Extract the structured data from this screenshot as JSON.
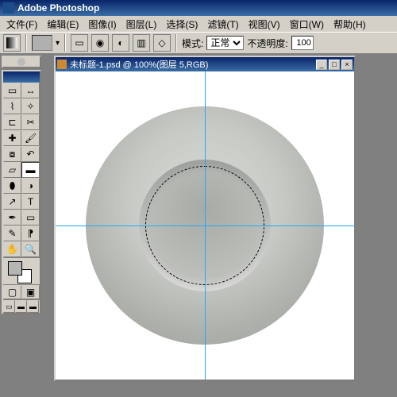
{
  "app": {
    "title": "Adobe Photoshop"
  },
  "menu": {
    "file": "文件(F)",
    "edit": "编辑(E)",
    "image": "图像(I)",
    "layer": "图层(L)",
    "select": "选择(S)",
    "filter": "滤镜(T)",
    "view": "视图(V)",
    "window": "窗口(W)",
    "help": "帮助(H)"
  },
  "options": {
    "mode_label": "模式:",
    "mode_value": "正常",
    "opacity_label": "不透明度:",
    "opacity_value": "100"
  },
  "document": {
    "title": "未标题-1.psd @ 100%(图层 5,RGB)"
  },
  "colors": {
    "foreground": "#b5b5b5",
    "background": "#ffffff",
    "guide": "#22aaff"
  },
  "tools": {
    "items": [
      "marquee",
      "move",
      "lasso",
      "wand",
      "crop",
      "slice",
      "heal",
      "brush",
      "stamp",
      "history",
      "eraser",
      "gradient",
      "blur",
      "dodge",
      "path",
      "type",
      "pen",
      "shape",
      "notes",
      "eyedrop",
      "hand",
      "zoom"
    ],
    "active": "gradient"
  }
}
